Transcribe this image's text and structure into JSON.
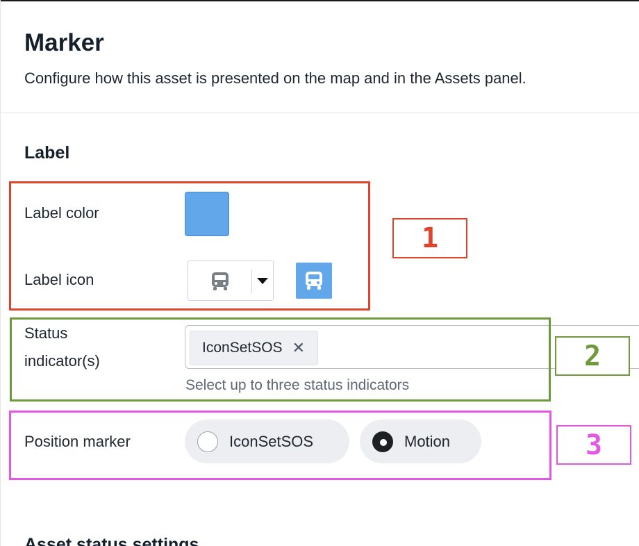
{
  "header": {
    "title": "Marker",
    "subtitle": "Configure how this asset is presented on the map and in the Assets panel."
  },
  "label_section": {
    "title": "Label",
    "color_label": "Label color",
    "color_value": "#62a7ea",
    "icon_label": "Label icon",
    "icon_name": "bus-icon"
  },
  "status": {
    "label_line1": "Status",
    "label_line2": "indicator(s)",
    "chip_label": "IconSetSOS",
    "chip_remove": "✕",
    "helper": "Select up to three status indicators"
  },
  "position": {
    "label": "Position marker",
    "options": [
      {
        "label": "IconSetSOS",
        "selected": false
      },
      {
        "label": "Motion",
        "selected": true
      }
    ]
  },
  "annotations": [
    {
      "number": "1",
      "color": "#e0442a"
    },
    {
      "number": "2",
      "color": "#6e9a3c"
    },
    {
      "number": "3",
      "color": "#e556e6"
    }
  ],
  "next_section": {
    "title": "Asset status settings"
  }
}
